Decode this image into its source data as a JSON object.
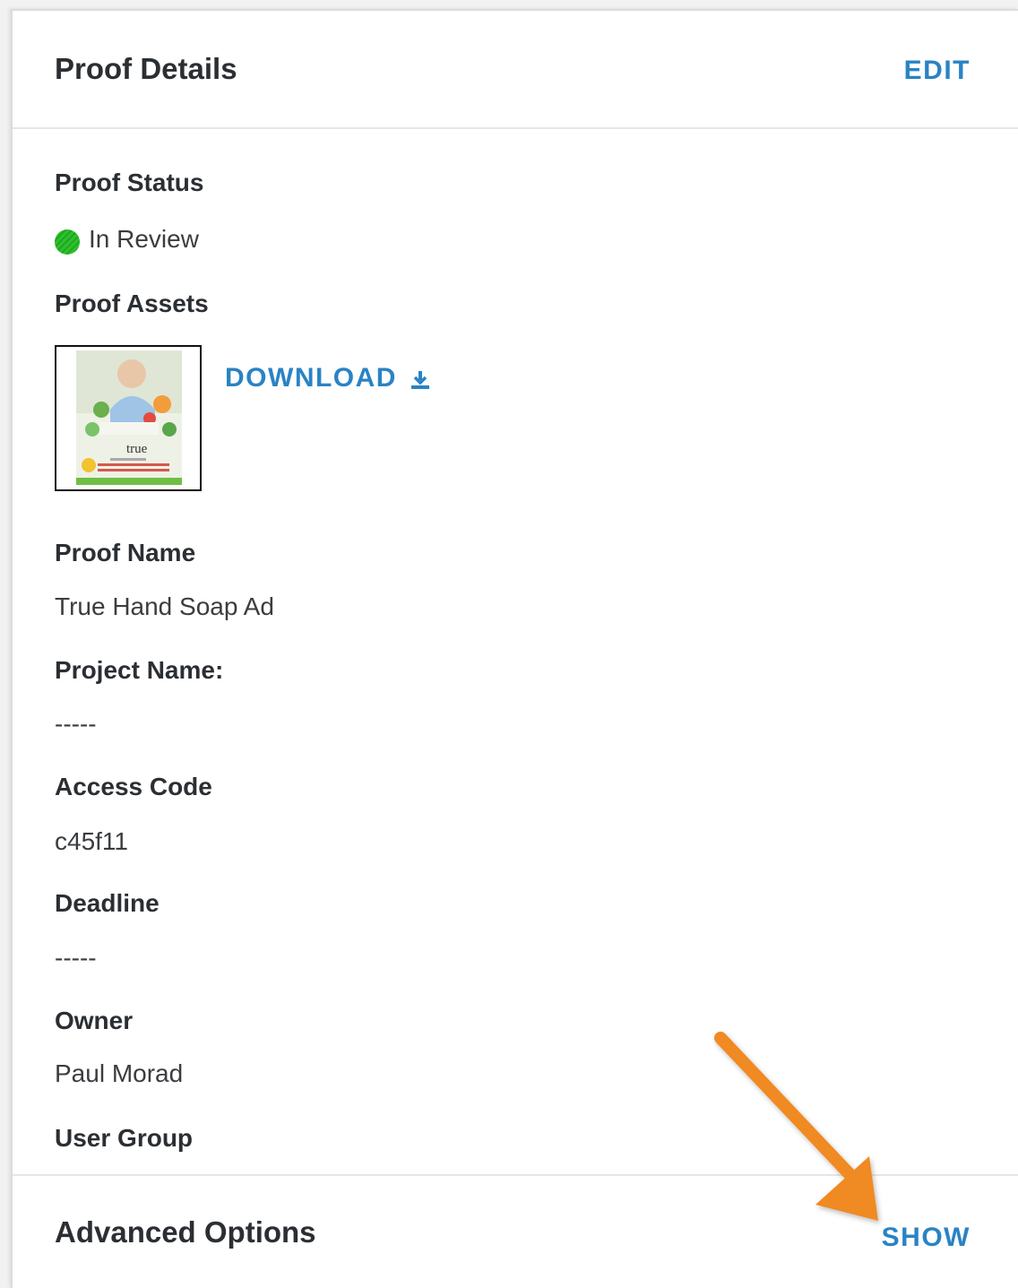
{
  "header": {
    "title": "Proof Details",
    "edit_label": "EDIT"
  },
  "proof_status": {
    "label": "Proof Status",
    "value": "In Review",
    "color": "#2ec22e"
  },
  "proof_assets": {
    "label": "Proof Assets",
    "download_label": "DOWNLOAD",
    "thumbnail_text": "true"
  },
  "proof_name": {
    "label": "Proof Name",
    "value": "True Hand Soap Ad"
  },
  "project_name": {
    "label": "Project Name:",
    "value": "-----"
  },
  "access_code": {
    "label": "Access Code",
    "value": "c45f11"
  },
  "deadline": {
    "label": "Deadline",
    "value": "-----"
  },
  "owner": {
    "label": "Owner",
    "value": "Paul Morad"
  },
  "user_group": {
    "label": "User Group"
  },
  "advanced": {
    "title": "Advanced Options",
    "show_label": "SHOW"
  },
  "colors": {
    "link": "#2a83c4",
    "arrow": "#f08a24",
    "text": "#2b2f33"
  }
}
